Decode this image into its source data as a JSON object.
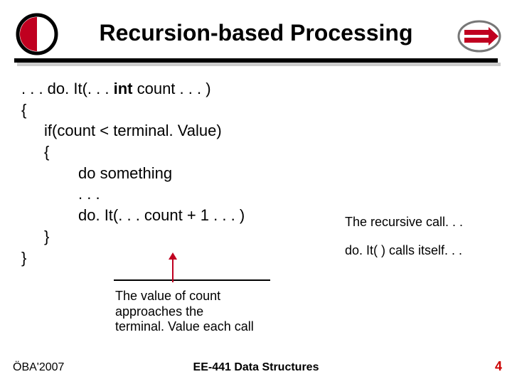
{
  "header": {
    "title": "Recursion-based Processing"
  },
  "code": {
    "line1_pre": ". . . do. It(. . . ",
    "line1_int": "int",
    "line1_post": " count . . . )",
    "line2": "{",
    "line3": "if(count < terminal. Value)",
    "line4": "{",
    "line5": "do something",
    "line6": ". . .",
    "line7": "do. It(. . . count + 1 . . . )",
    "line8": "}",
    "line9": "}"
  },
  "annotations": {
    "recursive": "The recursive call. . .",
    "calls_itself": "do. It( ) calls itself. . .",
    "value_count_l1": "The value of count",
    "value_count_l2": "approaches the",
    "value_count_l3": "terminal. Value each call"
  },
  "footer": {
    "left": "ÖBA'2007",
    "center": "EE-441 Data Structures",
    "page": "4"
  }
}
